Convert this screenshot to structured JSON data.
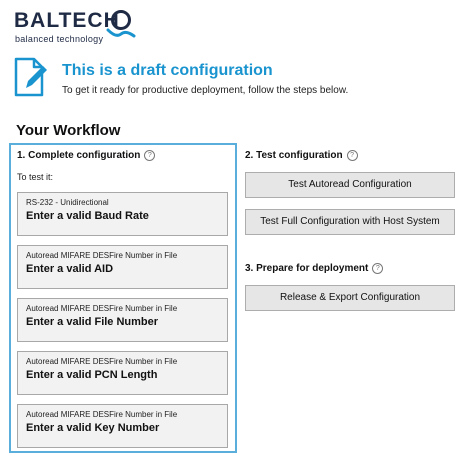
{
  "brand": {
    "name": "BALTECH",
    "tagline": "balanced technology",
    "colors": {
      "navy": "#1f2a44",
      "accent": "#1a94cf"
    }
  },
  "banner": {
    "icon": "draft-document-icon",
    "title": "This is a draft configuration",
    "subtitle": "To get it ready for productive deployment, follow the steps below."
  },
  "workflow": {
    "title": "Your Workflow",
    "step1": {
      "title": "1. Complete configuration",
      "test_label": "To test it:",
      "items": [
        {
          "context": "RS-232 - Unidirectional",
          "message": "Enter a valid Baud Rate"
        },
        {
          "context": "Autoread MIFARE DESFire Number in File",
          "message": "Enter a valid AID"
        },
        {
          "context": "Autoread MIFARE DESFire Number in File",
          "message": "Enter a valid File Number"
        },
        {
          "context": "Autoread MIFARE DESFire Number in File",
          "message": "Enter a valid PCN Length"
        },
        {
          "context": "Autoread MIFARE DESFire Number in File",
          "message": "Enter a valid Key Number"
        }
      ]
    },
    "step2": {
      "title": "2. Test configuration",
      "buttons": [
        "Test Autoread Configuration",
        "Test Full Configuration with Host System"
      ]
    },
    "step3": {
      "title": "3. Prepare for deployment",
      "buttons": [
        "Release & Export Configuration"
      ]
    },
    "help_glyph": "?"
  }
}
